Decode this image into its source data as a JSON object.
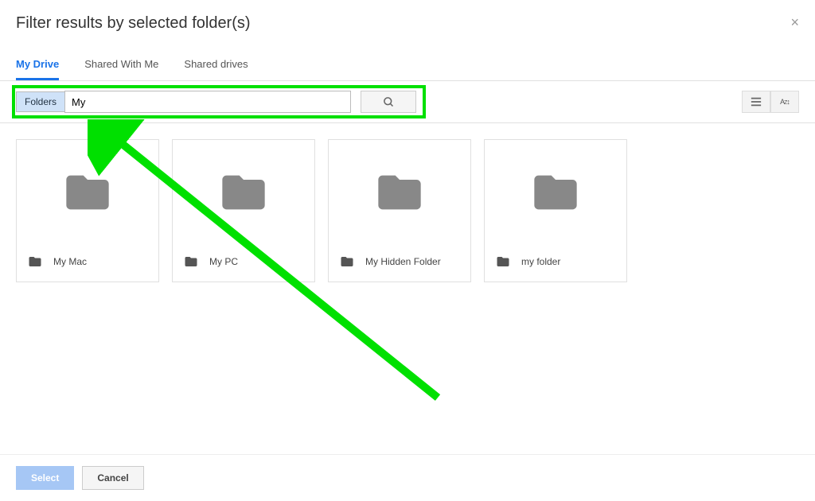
{
  "dialog": {
    "title": "Filter results by selected folder(s)",
    "close_symbol": "×"
  },
  "tabs": [
    {
      "label": "My Drive",
      "active": true
    },
    {
      "label": "Shared With Me",
      "active": false
    },
    {
      "label": "Shared drives",
      "active": false
    }
  ],
  "search": {
    "chip_label": "Folders",
    "input_value": "My"
  },
  "view_controls": {
    "list_view_label": "list-view",
    "sort_label": "A͏Z"
  },
  "folders": [
    {
      "name": "My Mac"
    },
    {
      "name": "My PC"
    },
    {
      "name": "My Hidden Folder"
    },
    {
      "name": "my folder"
    }
  ],
  "footer": {
    "select_label": "Select",
    "cancel_label": "Cancel"
  },
  "annotation": {
    "highlight_color": "#00e000"
  }
}
